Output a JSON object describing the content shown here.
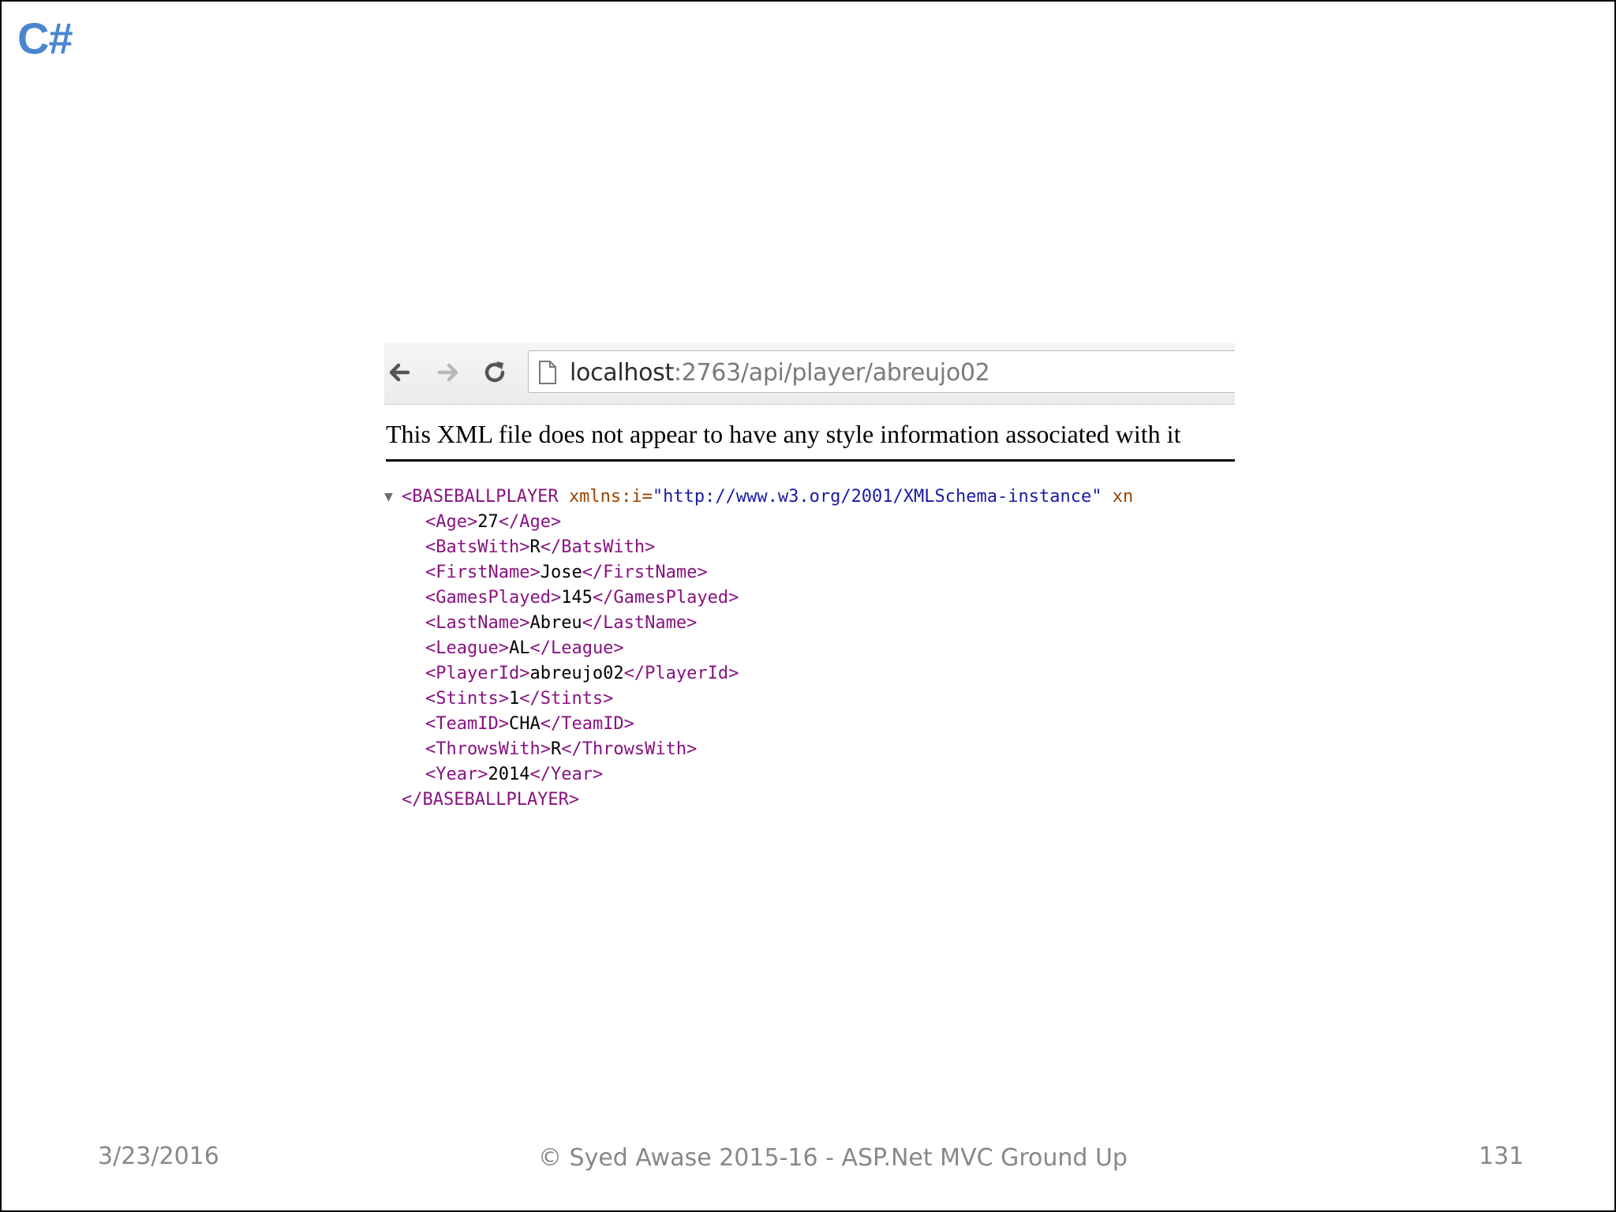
{
  "slide": {
    "brand": "C#",
    "footer": {
      "date": "3/23/2016",
      "copyright": "© Syed Awase 2015-16 - ASP.Net MVC Ground Up",
      "page_number": "131"
    }
  },
  "browser": {
    "nav_icons": [
      "back-arrow",
      "forward-arrow",
      "reload"
    ],
    "address": {
      "host": "localhost",
      "rest": ":2763/api/player/abreujo02"
    },
    "notice": "This XML file does not appear to have any style information associated with it"
  },
  "xml": {
    "root_open": {
      "toggle": "▼",
      "tag_open": "<BASEBALLPLAYER",
      "attr_name": "xmlns:i",
      "attr_eq": "=",
      "attr_value": "\"http://www.w3.org/2001/XMLSchema-instance\"",
      "attr_next": "xn"
    },
    "children": [
      {
        "open": "<Age>",
        "value": "27",
        "close": "</Age>"
      },
      {
        "open": "<BatsWith>",
        "value": "R",
        "close": "</BatsWith>"
      },
      {
        "open": "<FirstName>",
        "value": "Jose",
        "close": "</FirstName>"
      },
      {
        "open": "<GamesPlayed>",
        "value": "145",
        "close": "</GamesPlayed>"
      },
      {
        "open": "<LastName>",
        "value": "Abreu",
        "close": "</LastName>"
      },
      {
        "open": "<League>",
        "value": "AL",
        "close": "</League>"
      },
      {
        "open": "<PlayerId>",
        "value": "abreujo02",
        "close": "</PlayerId>"
      },
      {
        "open": "<Stints>",
        "value": "1",
        "close": "</Stints>"
      },
      {
        "open": "<TeamID>",
        "value": "CHA",
        "close": "</TeamID>"
      },
      {
        "open": "<ThrowsWith>",
        "value": "R",
        "close": "</ThrowsWith>"
      },
      {
        "open": "<Year>",
        "value": "2014",
        "close": "</Year>"
      }
    ],
    "root_close": "</BASEBALLPLAYER>"
  },
  "colors": {
    "brand": "#4a86d0",
    "xml_tag": "#881280",
    "xml_attr": "#994500",
    "xml_attr_value": "#1a1aa6",
    "footer_text": "#888888"
  }
}
